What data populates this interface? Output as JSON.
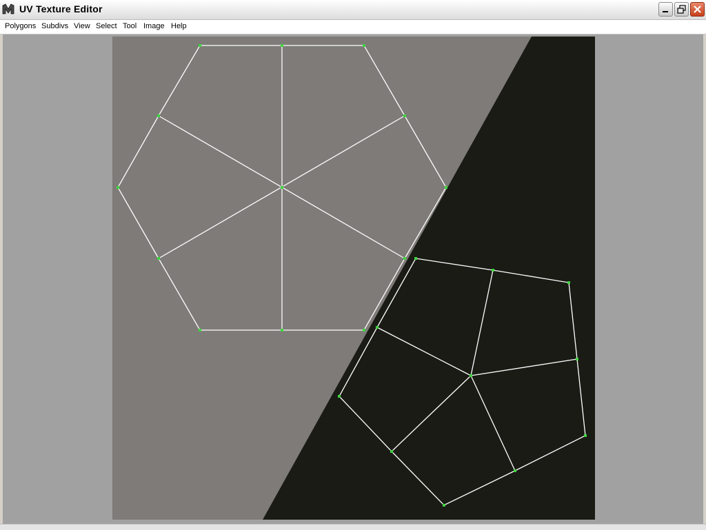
{
  "window": {
    "title": "UV Texture Editor",
    "icon": "maya-app-icon",
    "controls": [
      "minimize-icon",
      "restore-icon",
      "close-icon"
    ]
  },
  "menubar": {
    "items": [
      {
        "label": "Polygons"
      },
      {
        "label": "Subdivs"
      },
      {
        "label": "View"
      },
      {
        "label": "Select"
      },
      {
        "label": "Tool"
      },
      {
        "label": "Image"
      },
      {
        "label": "Help"
      }
    ]
  },
  "colors": {
    "editor_background": "#a1a1a1",
    "texture_light": "#7e7b78",
    "texture_dark": "#1b1b16",
    "uv_edge": "#ffffff",
    "uv_vertex": "#3fd43f"
  },
  "uv_shells": [
    {
      "name": "hexagon",
      "vertex_count": 13,
      "face_count": 6
    },
    {
      "name": "pentagon",
      "vertex_count": 11,
      "face_count": 5
    }
  ]
}
